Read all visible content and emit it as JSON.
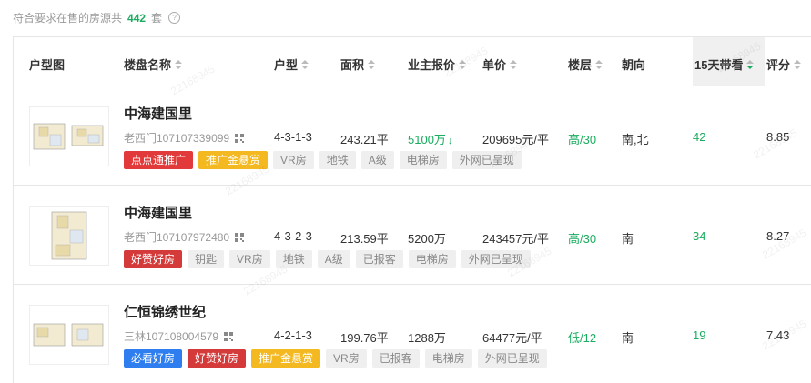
{
  "summary": {
    "prefix": "符合要求在售的房源共",
    "count": "442",
    "unit": "套"
  },
  "headers": {
    "floorplan": "户型图",
    "name": "楼盘名称",
    "layout": "户型",
    "area": "面积",
    "price": "业主报价",
    "unit_price": "单价",
    "floor": "楼层",
    "orientation": "朝向",
    "views15": "15天带看",
    "score": "评分"
  },
  "watermark_text": "22168945",
  "rows": [
    {
      "name": "中海建国里",
      "code": "老西门107107339099",
      "layout": "4-3-1-3",
      "area": "243.21平",
      "price": "5100万",
      "price_arrow": "↓",
      "unit_price": "209695元/平",
      "floor": "高/30",
      "orientation": "南,北",
      "views15": "42",
      "score": "8.85",
      "tags": [
        {
          "label": "点点通推广",
          "style": "red"
        },
        {
          "label": "推广金悬赏",
          "style": "gold"
        },
        {
          "label": "VR房",
          "style": "gray"
        },
        {
          "label": "地铁",
          "style": "gray"
        },
        {
          "label": "A级",
          "style": "gray"
        },
        {
          "label": "电梯房",
          "style": "gray"
        },
        {
          "label": "外网已呈现",
          "style": "gray"
        }
      ]
    },
    {
      "name": "中海建国里",
      "code": "老西门107107972480",
      "layout": "4-3-2-3",
      "area": "213.59平",
      "price": "5200万",
      "price_arrow": "",
      "unit_price": "243457元/平",
      "floor": "高/30",
      "orientation": "南",
      "views15": "34",
      "score": "8.27",
      "tags": [
        {
          "label": "好赞好房",
          "style": "dred"
        },
        {
          "label": "钥匙",
          "style": "gray"
        },
        {
          "label": "VR房",
          "style": "gray"
        },
        {
          "label": "地铁",
          "style": "gray"
        },
        {
          "label": "A级",
          "style": "gray"
        },
        {
          "label": "已报客",
          "style": "gray"
        },
        {
          "label": "电梯房",
          "style": "gray"
        },
        {
          "label": "外网已呈现",
          "style": "gray"
        }
      ]
    },
    {
      "name": "仁恒锦绣世纪",
      "code": "三林107108004579",
      "layout": "4-2-1-3",
      "area": "199.76平",
      "price": "1288万",
      "price_arrow": "",
      "unit_price": "64477元/平",
      "floor": "低/12",
      "orientation": "南",
      "views15": "19",
      "score": "7.43",
      "tags": [
        {
          "label": "必看好房",
          "style": "blue"
        },
        {
          "label": "好赞好房",
          "style": "dred"
        },
        {
          "label": "推广金悬赏",
          "style": "gold"
        },
        {
          "label": "VR房",
          "style": "gray"
        },
        {
          "label": "已报客",
          "style": "gray"
        },
        {
          "label": "电梯房",
          "style": "gray"
        },
        {
          "label": "外网已呈现",
          "style": "gray"
        }
      ]
    }
  ]
}
